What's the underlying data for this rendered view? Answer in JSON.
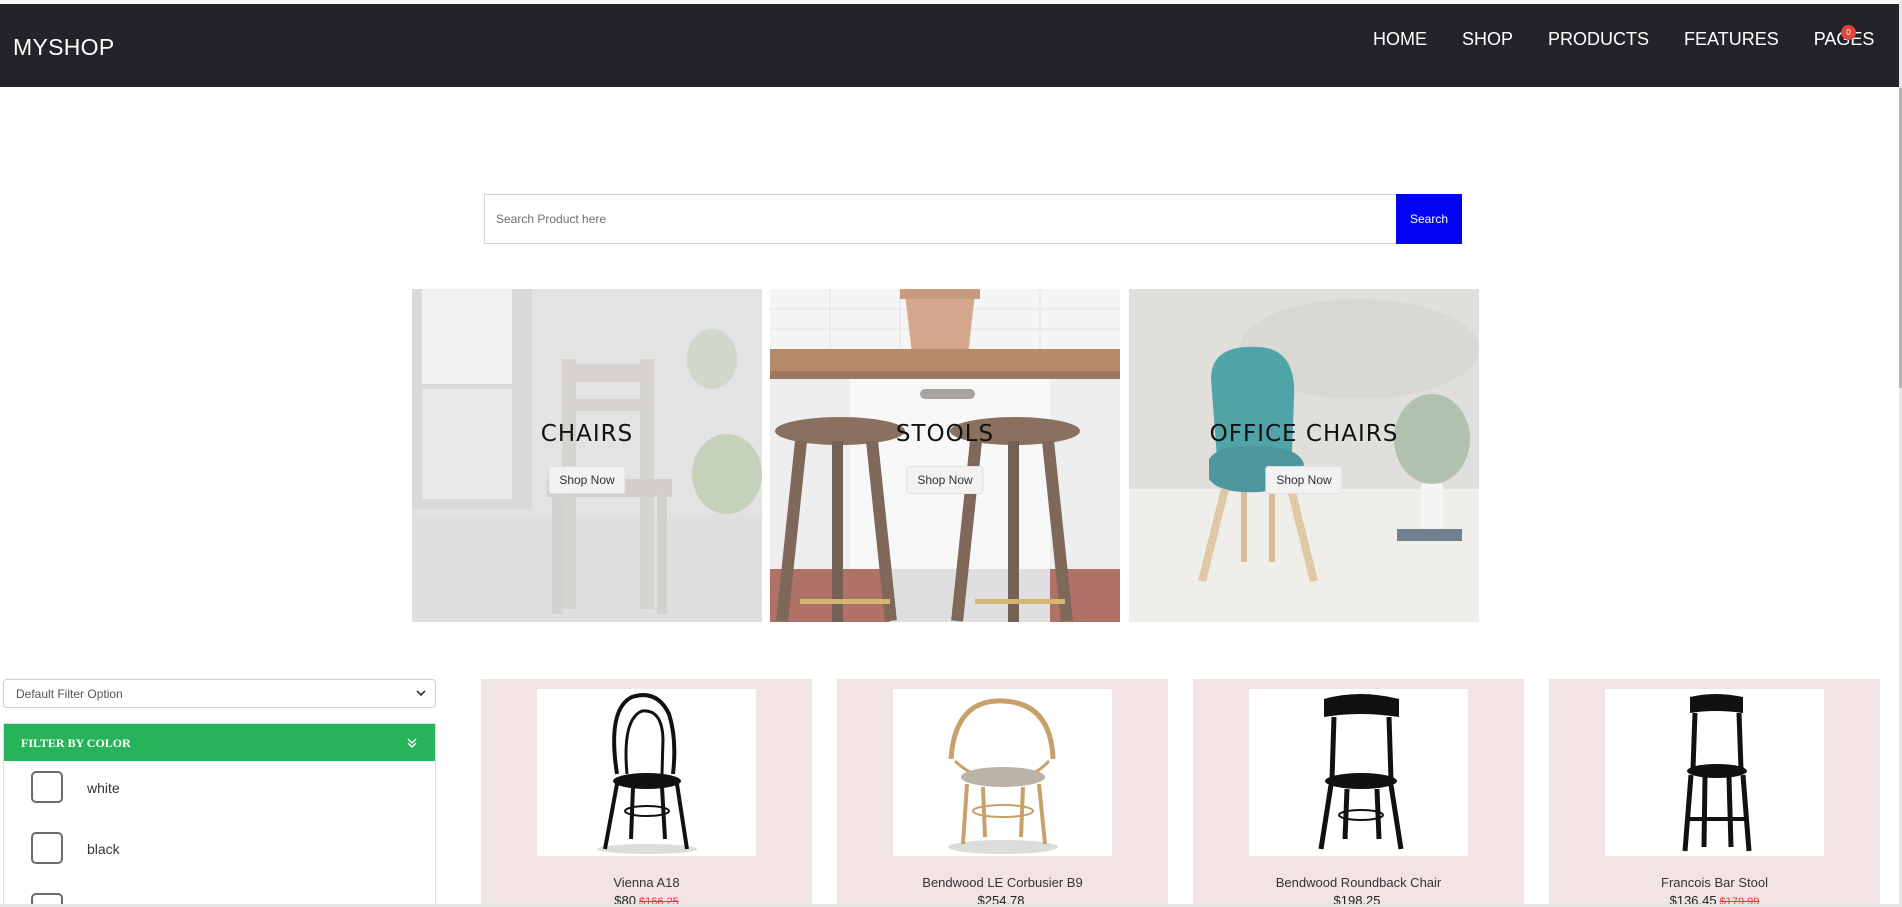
{
  "navbar": {
    "brand": "MYSHOP",
    "links": [
      "HOME",
      "SHOP",
      "PRODUCTS",
      "FEATURES",
      "PAGES"
    ],
    "cart_count": "0",
    "cart_icon": "cart-icon",
    "background": "#232427"
  },
  "search": {
    "placeholder": "Search Product here",
    "button_label": "Search",
    "button_color": "#0202f5"
  },
  "categories": [
    {
      "title": "CHAIRS",
      "button": "Shop Now"
    },
    {
      "title": "STOOLS",
      "button": "Shop Now"
    },
    {
      "title": "OFFICE CHAIRS",
      "button": "Shop Now"
    }
  ],
  "sidebar": {
    "filter_select": "Default Filter Option",
    "color_filter": {
      "title": "FILTER BY COLOR",
      "header_color": "#27b35a",
      "options": [
        "white",
        "black"
      ]
    }
  },
  "products": [
    {
      "name": "Vienna A18",
      "price": "$80",
      "old_price": "$166.25"
    },
    {
      "name": "Bendwood LE Corbusier B9",
      "price": "$254.78",
      "old_price": ""
    },
    {
      "name": "Bendwood Roundback Chair",
      "price": "$198.25",
      "old_price": ""
    },
    {
      "name": "Francois Bar Stool",
      "price": "$136.45",
      "old_price": "$179.99"
    }
  ]
}
